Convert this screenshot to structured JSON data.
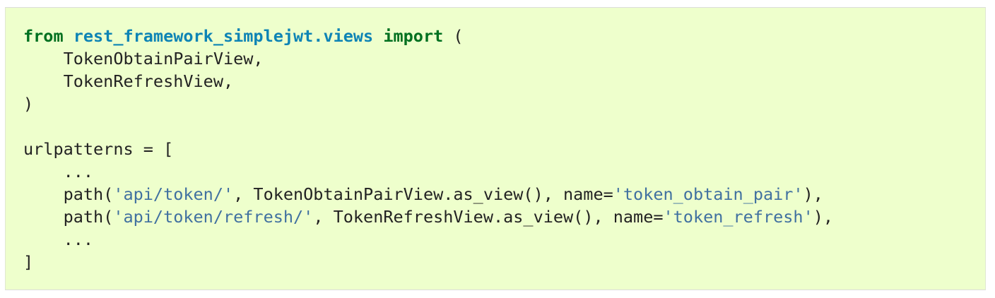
{
  "code_block": {
    "language": "python",
    "background_color": "#eeffcc",
    "colors": {
      "keyword": "#007020",
      "namespace": "#0e84b5",
      "string": "#4070a0",
      "text": "#222222"
    },
    "lines": [
      [
        {
          "type": "kw",
          "text": "from"
        },
        {
          "type": "plain",
          "text": " "
        },
        {
          "type": "ns",
          "text": "rest_framework_simplejwt.views"
        },
        {
          "type": "plain",
          "text": " "
        },
        {
          "type": "kw",
          "text": "import"
        },
        {
          "type": "plain",
          "text": " ("
        }
      ],
      [
        {
          "type": "plain",
          "text": "    TokenObtainPairView,"
        }
      ],
      [
        {
          "type": "plain",
          "text": "    TokenRefreshView,"
        }
      ],
      [
        {
          "type": "plain",
          "text": ")"
        }
      ],
      [],
      [
        {
          "type": "plain",
          "text": "urlpatterns = ["
        }
      ],
      [
        {
          "type": "plain",
          "text": "    ..."
        }
      ],
      [
        {
          "type": "plain",
          "text": "    path("
        },
        {
          "type": "str",
          "text": "'api/token/'"
        },
        {
          "type": "plain",
          "text": ", TokenObtainPairView.as_view(), name="
        },
        {
          "type": "str",
          "text": "'token_obtain_pair'"
        },
        {
          "type": "plain",
          "text": "),"
        }
      ],
      [
        {
          "type": "plain",
          "text": "    path("
        },
        {
          "type": "str",
          "text": "'api/token/refresh/'"
        },
        {
          "type": "plain",
          "text": ", TokenRefreshView.as_view(), name="
        },
        {
          "type": "str",
          "text": "'token_refresh'"
        },
        {
          "type": "plain",
          "text": "),"
        }
      ],
      [
        {
          "type": "plain",
          "text": "    ..."
        }
      ],
      [
        {
          "type": "plain",
          "text": "]"
        }
      ]
    ]
  }
}
